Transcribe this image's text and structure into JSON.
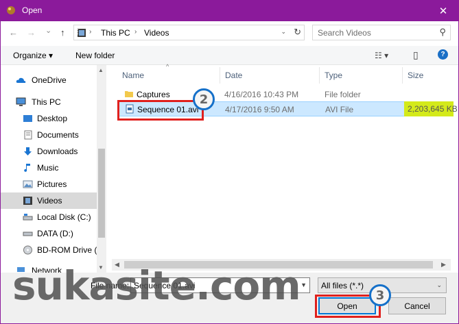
{
  "window": {
    "title": "Open",
    "close_glyph": "✕"
  },
  "nav": {
    "back_glyph": "←",
    "forward_glyph": "→",
    "dropdown_glyph": "⌄",
    "up_glyph": "↑",
    "breadcrumb": [
      "This PC",
      "Videos"
    ],
    "separator": "›",
    "refresh_glyph": "↻",
    "search_placeholder": "Search Videos",
    "search_glyph": "⚲"
  },
  "toolbar": {
    "organize_label": "Organize ▾",
    "new_folder_label": "New folder",
    "view_glyph": "☷ ▾",
    "preview_glyph": "▯",
    "help_glyph": "?"
  },
  "sidebar": {
    "items": [
      {
        "label": "OneDrive",
        "icon": "cloud-icon"
      },
      {
        "label": "This PC",
        "icon": "computer-icon"
      },
      {
        "label": "Desktop",
        "icon": "desktop-icon"
      },
      {
        "label": "Documents",
        "icon": "documents-icon"
      },
      {
        "label": "Downloads",
        "icon": "downloads-icon"
      },
      {
        "label": "Music",
        "icon": "music-icon"
      },
      {
        "label": "Pictures",
        "icon": "pictures-icon"
      },
      {
        "label": "Videos",
        "icon": "videos-icon"
      },
      {
        "label": "Local Disk (C:)",
        "icon": "disk-icon"
      },
      {
        "label": "DATA (D:)",
        "icon": "disk-icon"
      },
      {
        "label": "BD-ROM Drive (I",
        "icon": "disc-icon"
      },
      {
        "label": "Network",
        "icon": "network-icon"
      }
    ],
    "selected": "Videos"
  },
  "columns": {
    "name": "Name",
    "date": "Date",
    "type": "Type",
    "size": "Size",
    "sort_glyph": "^"
  },
  "files": [
    {
      "name": "Captures",
      "date": "4/16/2016 10:43 PM",
      "type": "File folder",
      "size": ""
    },
    {
      "name": "Sequence 01.avi",
      "date": "4/17/2016 9:50 AM",
      "type": "AVI File",
      "size": "2,203,645 KB"
    }
  ],
  "bottom": {
    "file_name_label": "File name:",
    "file_name_value": "Sequence 01.avi",
    "filter_value": "All files (*.*)",
    "open_label": "Open",
    "cancel_label": "Cancel"
  },
  "annotations": {
    "badge_2": "2",
    "badge_3": "3"
  },
  "watermark": "sukasite.com",
  "colors": {
    "titlebar": "#8b1a9b",
    "selection": "#cce8ff",
    "highlight": "#d4ea1a",
    "callout_red": "#e0201d",
    "badge_blue": "#1570c9"
  }
}
